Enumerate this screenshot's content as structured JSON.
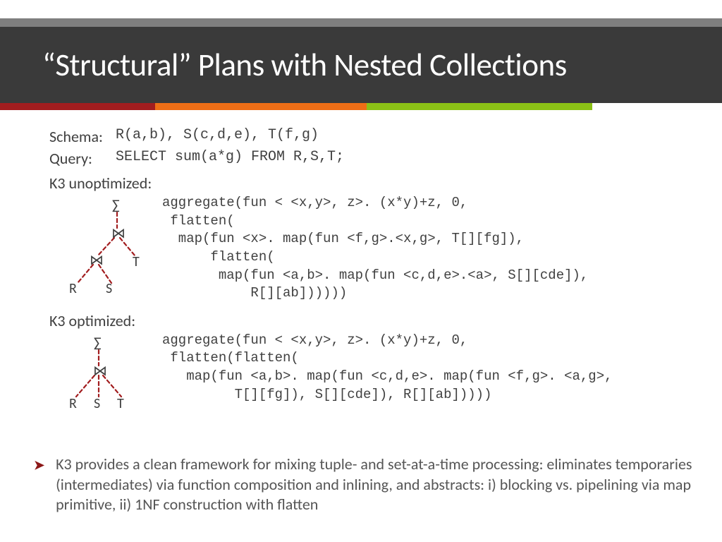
{
  "title": "“Structural” Plans with Nested Collections",
  "schema_label": "Schema:",
  "schema_value": "R(a,b), S(c,d,e), T(f,g)",
  "query_label": "Query:",
  "query_value": "SELECT sum(a*g) FROM R,S,T;",
  "k3_unopt_label": "K3 unoptimized:",
  "k3_opt_label": "K3 optimized:",
  "unopt_code": "aggregate(fun < <x,y>, z>. (x*y)+z, 0,\n flatten(\n  map(fun <x>. map(fun <f,g>.<x,g>, T[][fg]),\n      flatten(\n       map(fun <a,b>. map(fun <c,d,e>.<a>, S[][cde]),\n           R[][ab])))))",
  "opt_code": "aggregate(fun < <x,y>, z>. (x*y)+z, 0,\n flatten(flatten(\n   map(fun <a,b>. map(fun <c,d,e>. map(fun <f,g>. <a,g>,\n         T[][fg]), S[][cde]), R[][ab]))))",
  "bullet": "K3 provides a clean framework for mixing tuple- and set-at-a-time processing: eliminates temporaries (intermediates) via function composition and inlining, and abstracts:\ni) blocking vs. pipelining via map primitive, ii) 1NF construction with flatten",
  "tree_unopt": {
    "sigma": "∑",
    "join": "⋈",
    "R": "R",
    "S": "S",
    "T": "T"
  },
  "tree_opt": {
    "sigma": "∑",
    "join": "⋈",
    "R": "R",
    "S": "S",
    "T": "T"
  }
}
